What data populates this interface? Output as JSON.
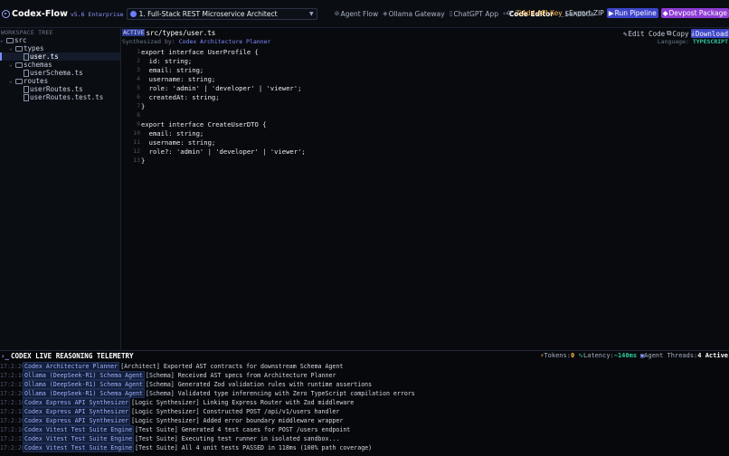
{
  "app": {
    "title": "Codex-Flow",
    "version": "v5.6 Enterprise",
    "project": "1. Full-Stack REST Microservice Architect"
  },
  "nav": [
    {
      "label": "Agent Flow",
      "icon": "agent-flow-icon",
      "active": false
    },
    {
      "label": "Ollama Gateway",
      "icon": "gateway-icon",
      "active": false
    },
    {
      "label": "ChatGPT App",
      "icon": "app-icon",
      "active": false
    },
    {
      "label": "Code Editor",
      "icon": "code-icon",
      "active": true
    },
    {
      "label": "Sandbox",
      "icon": "terminal-icon",
      "active": false
    }
  ],
  "actions": {
    "api_key": "Add API Key",
    "zip": "Export ZIP",
    "run": "Run Pipeline",
    "devpost": "Devpost Package"
  },
  "sidebar": {
    "title": "WORKSPACE TREE",
    "tree": [
      {
        "name": "src",
        "type": "folder",
        "depth": 0
      },
      {
        "name": "types",
        "type": "folder",
        "depth": 1
      },
      {
        "name": "user.ts",
        "type": "file",
        "depth": 2,
        "selected": true
      },
      {
        "name": "schemas",
        "type": "folder",
        "depth": 1
      },
      {
        "name": "userSchema.ts",
        "type": "file",
        "depth": 2
      },
      {
        "name": "routes",
        "type": "folder",
        "depth": 1
      },
      {
        "name": "userRoutes.ts",
        "type": "file",
        "depth": 2
      },
      {
        "name": "userRoutes.test.ts",
        "type": "file",
        "depth": 2
      }
    ]
  },
  "editor": {
    "badge": "ACTIVE",
    "path": "src/types/user.ts",
    "synth_label": "Synthesized by:",
    "synth_agent": "Codex Architecture Planner",
    "lang_label": "Language:",
    "lang": "TYPESCRIPT",
    "tools": {
      "edit": "Edit Code",
      "copy": "Copy",
      "download": "Download"
    },
    "lines": [
      "export interface UserProfile {",
      "  id: string;",
      "  email: string;",
      "  username: string;",
      "  role: 'admin' | 'developer' | 'viewer';",
      "  createdAt: string;",
      "}",
      "",
      "export interface CreateUserDTO {",
      "  email: string;",
      "  username: string;",
      "  role?: 'admin' | 'developer' | 'viewer';",
      "}"
    ]
  },
  "telemetry": {
    "title": "CODEX LIVE REASONING TELEMETRY",
    "tokens_label": "Tokens:",
    "tokens": "0",
    "latency_label": "Latency:",
    "latency": "~140ms",
    "threads_label": "Agent Threads:",
    "threads": "4 Active",
    "logs": [
      {
        "time": "17:2:20",
        "source": "Codex Architecture Planner",
        "msg": "[Architect] Exported AST contracts for downstream Schema Agent"
      },
      {
        "time": "17:2:10",
        "source": "Ollama (DeepSeek-R1) Schema Agent",
        "msg": "[Schema] Received AST specs from Architecture Planner"
      },
      {
        "time": "17:2:15",
        "source": "Ollama (DeepSeek-R1) Schema Agent",
        "msg": "[Schema] Generated Zod validation rules with runtime assertions"
      },
      {
        "time": "17:2:20",
        "source": "Ollama (DeepSeek-R1) Schema Agent",
        "msg": "[Schema] Validated type inferencing with Zero TypeScript compilation errors"
      },
      {
        "time": "17:2:10",
        "source": "Codex Express API Synthesizer",
        "msg": "[Logic Synthesizer] Linking Express Router with Zod middleware"
      },
      {
        "time": "17:2:15",
        "source": "Codex Express API Synthesizer",
        "msg": "[Logic Synthesizer] Constructed POST /api/v1/users handler"
      },
      {
        "time": "17:2:20",
        "source": "Codex Express API Synthesizer",
        "msg": "[Logic Synthesizer] Added error boundary middleware wrapper"
      },
      {
        "time": "17:2:10",
        "source": "Codex Vitest Test Suite Engine",
        "msg": "[Test Suite] Generated 4 test cases for POST /users endpoint"
      },
      {
        "time": "17:2:15",
        "source": "Codex Vitest Test Suite Engine",
        "msg": "[Test Suite] Executing test runner in isolated sandbox..."
      },
      {
        "time": "17:2:20",
        "source": "Codex Vitest Test Suite Engine",
        "msg": "[Test Suite] All 4 unit tests PASSED in 118ms (100% path coverage)"
      }
    ]
  }
}
